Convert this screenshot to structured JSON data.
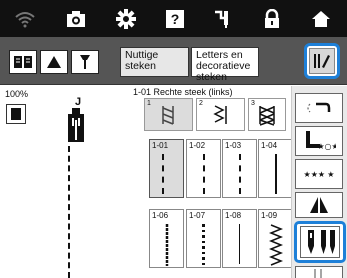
{
  "topbar": {
    "icons": [
      "wifi-icon",
      "camera-icon",
      "settings-icon",
      "help-icon",
      "needle-icon",
      "lock-icon",
      "home-icon"
    ]
  },
  "category_tabs": {
    "useful_stitches": "Nuttige steken",
    "letters_decorative": "Letters en decoratieve steken"
  },
  "left_panel": {
    "zoom_level": "100%",
    "presser_foot_code": "J"
  },
  "stitch_name": "1-01  Rechte steek (links)",
  "stitch_types": [
    {
      "num": "1",
      "icon": "straight-stitch-type-icon"
    },
    {
      "num": "2",
      "icon": "overlock-stitch-type-icon"
    },
    {
      "num": "3",
      "icon": "cross-stitch-type-icon"
    }
  ],
  "stitches": [
    {
      "id": "1-01"
    },
    {
      "id": "1-02"
    },
    {
      "id": "1-03"
    },
    {
      "id": "1-04"
    },
    {
      "id": "1-06"
    },
    {
      "id": "1-07"
    },
    {
      "id": "1-08"
    },
    {
      "id": "1-09"
    }
  ],
  "side_buttons": {
    "stars_label": "★★★ ★"
  },
  "colors": {
    "accent": "#1e80d8",
    "topbar": "#111111",
    "panel": "#555555"
  }
}
